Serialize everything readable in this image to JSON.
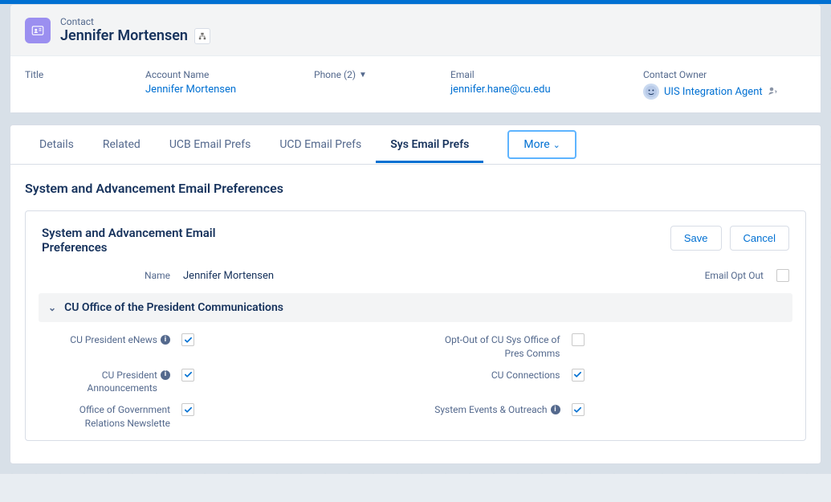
{
  "header": {
    "recordType": "Contact",
    "name": "Jennifer Mortensen"
  },
  "fields": {
    "titleLabel": "Title",
    "titleValue": "",
    "accountLabel": "Account Name",
    "accountValue": "Jennifer Mortensen",
    "phoneLabel": "Phone (2)",
    "phoneValue": "",
    "emailLabel": "Email",
    "emailValue": "jennifer.hane@cu.edu",
    "ownerLabel": "Contact Owner",
    "ownerValue": "UIS Integration Agent"
  },
  "tabs": {
    "details": "Details",
    "related": "Related",
    "ucb": "UCB Email Prefs",
    "ucd": "UCD Email Prefs",
    "sys": "Sys Email Prefs",
    "more": "More"
  },
  "panel": {
    "title": "System and Advancement Email Preferences",
    "cardTitle": "System and Advancement Email Preferences",
    "save": "Save",
    "cancel": "Cancel",
    "nameLabel": "Name",
    "nameValue": "Jennifer Mortensen",
    "optOutLabel": "Email Opt Out",
    "optOutChecked": false,
    "sectionTitle": "CU Office of the President Communications",
    "prefs": [
      {
        "label": "CU President eNews",
        "info": true,
        "checked": true
      },
      {
        "label": "Opt-Out of CU Sys Office of Pres Comms",
        "info": false,
        "checked": false
      },
      {
        "label": "CU President Announcements",
        "info": true,
        "checked": true
      },
      {
        "label": "CU Connections",
        "info": false,
        "checked": true
      },
      {
        "label": "Office of Government Relations Newslette",
        "info": false,
        "checked": true
      },
      {
        "label": "System Events & Outreach",
        "info": true,
        "checked": true
      }
    ]
  }
}
